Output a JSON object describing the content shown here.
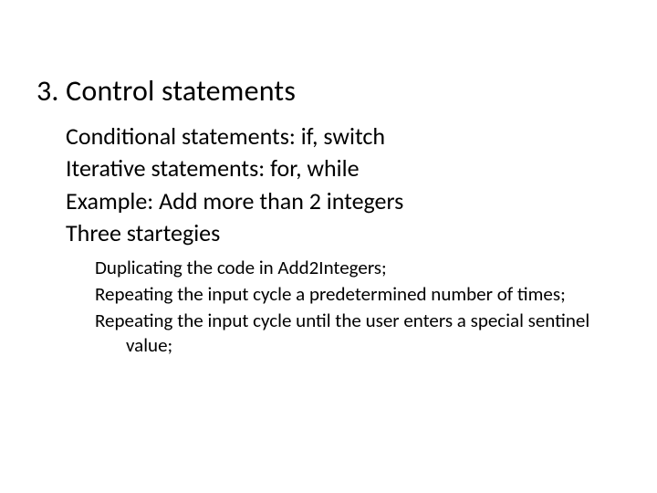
{
  "heading": "3.  Control statements",
  "level1": {
    "line1": "Conditional statements: if, switch",
    "line2": "Iterative statements: for, while",
    "line3": "Example: Add more than 2 integers",
    "line4": "Three startegies"
  },
  "level2": {
    "line1": "Duplicating  the code in Add2Integers;",
    "line2": "Repeating the input cycle a predetermined number of times;",
    "line3": "Repeating the input cycle until the user enters a special sentinel value;"
  }
}
